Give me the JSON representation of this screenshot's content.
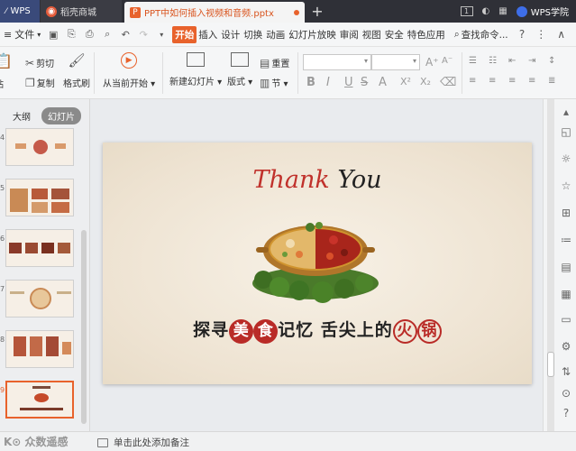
{
  "titlebar": {
    "tabs": [
      {
        "label": "WPS"
      },
      {
        "label": "稻壳商城"
      },
      {
        "label": "PPT中如何插入视频和音频.pptx"
      }
    ],
    "new_tab": "+",
    "page_badge": "1",
    "academy": "WPS学院"
  },
  "menubar": {
    "file": "文件",
    "items": [
      "开始",
      "插入",
      "设计",
      "切换",
      "动画",
      "幻灯片放映",
      "审阅",
      "视图",
      "安全",
      "特色应用"
    ],
    "search": "查找命令..."
  },
  "ribbon": {
    "paste_label": "贴",
    "cut_label": "剪切",
    "copy_label": "复制",
    "format_painter_label": "格式刷",
    "from_current_label": "从当前开始",
    "new_slide_label": "新建幻灯片",
    "layout_label": "版式",
    "reset_label": "重置",
    "section_label": "节",
    "font_format_glyphs": [
      "B",
      "I",
      "U",
      "S",
      "A",
      "X²",
      "X₂"
    ]
  },
  "leftpanel": {
    "tabs": [
      "大纲",
      "幻灯片"
    ],
    "thumb_numbers": [
      "4",
      "5",
      "6",
      "7",
      "8",
      "9"
    ]
  },
  "slide": {
    "title_part1": "Thank",
    "title_part2": "You",
    "subtitle_a": "探寻",
    "subtitle_b": "美",
    "subtitle_c": "食",
    "subtitle_d": "记忆 舌尖上的",
    "subtitle_e": "火",
    "subtitle_f": "锅"
  },
  "status": {
    "notes_placeholder": "单击此处添加备注",
    "watermark": "K⊙ 众数遥感"
  },
  "colors": {
    "accent": "#e8622c",
    "title_red": "#c0312b",
    "seal_red": "#b92b27"
  }
}
